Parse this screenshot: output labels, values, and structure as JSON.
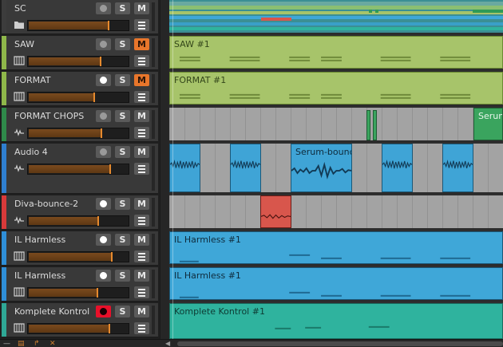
{
  "tracks": [
    {
      "name": "SC",
      "color": "#3c3c3c",
      "type": "folder",
      "rec_armed": false,
      "muted": false,
      "volume_pct": 79,
      "s_label": "S",
      "m_label": "M"
    },
    {
      "name": "SAW",
      "color": "#8fb84a",
      "type": "instrument",
      "rec_armed": false,
      "muted": true,
      "volume_pct": 71,
      "s_label": "S",
      "m_label": "M"
    },
    {
      "name": "FORMAT",
      "color": "#8fb84a",
      "type": "instrument",
      "rec_armed": true,
      "muted": true,
      "volume_pct": 65,
      "s_label": "S",
      "m_label": "M"
    },
    {
      "name": "FORMAT CHOPS",
      "color": "#2f8a4a",
      "type": "audio",
      "rec_armed": false,
      "muted": false,
      "volume_pct": 72,
      "s_label": "S",
      "m_label": "M"
    },
    {
      "name": "Audio 4",
      "color": "#2f7fd0",
      "type": "audio",
      "rec_armed": false,
      "muted": false,
      "volume_pct": 81,
      "s_label": "S",
      "m_label": "M"
    },
    {
      "name": "Diva-bounce-2",
      "color": "#d83a3a",
      "type": "audio",
      "rec_armed": true,
      "muted": false,
      "volume_pct": 69,
      "s_label": "S",
      "m_label": "M"
    },
    {
      "name": "IL Harmless",
      "color": "#2f8fd8",
      "type": "instrument",
      "rec_armed": true,
      "muted": false,
      "volume_pct": 82,
      "s_label": "S",
      "m_label": "M"
    },
    {
      "name": "IL Harmless",
      "color": "#2f8fd8",
      "type": "instrument",
      "rec_armed": true,
      "muted": false,
      "volume_pct": 68,
      "s_label": "S",
      "m_label": "M"
    },
    {
      "name": "Komplete Kontrol",
      "color": "#2fa896",
      "type": "instrument",
      "rec_armed": true,
      "rec_red": true,
      "muted": false,
      "volume_pct": 80,
      "s_label": "S",
      "m_label": "M"
    }
  ],
  "clips": {
    "saw": "SAW #1",
    "format": "FORMAT #1",
    "chops_serum": "Serum",
    "audio4_serum": "Serum-bounc",
    "harmless1": "IL Harmless #1",
    "harmless2": "IL Harmless #1",
    "komplete": "Komplete Kontrol #1"
  },
  "colors": {
    "green_clip": "#a7c46a",
    "blue_clip": "#3fa7d8",
    "teal_clip": "#2fb39e",
    "red_clip": "#d8564c",
    "accent_orange": "#e8762b"
  },
  "bottom_icons": [
    "tracks-icon",
    "layout-icon",
    "arrow-icon",
    "close-icon"
  ]
}
